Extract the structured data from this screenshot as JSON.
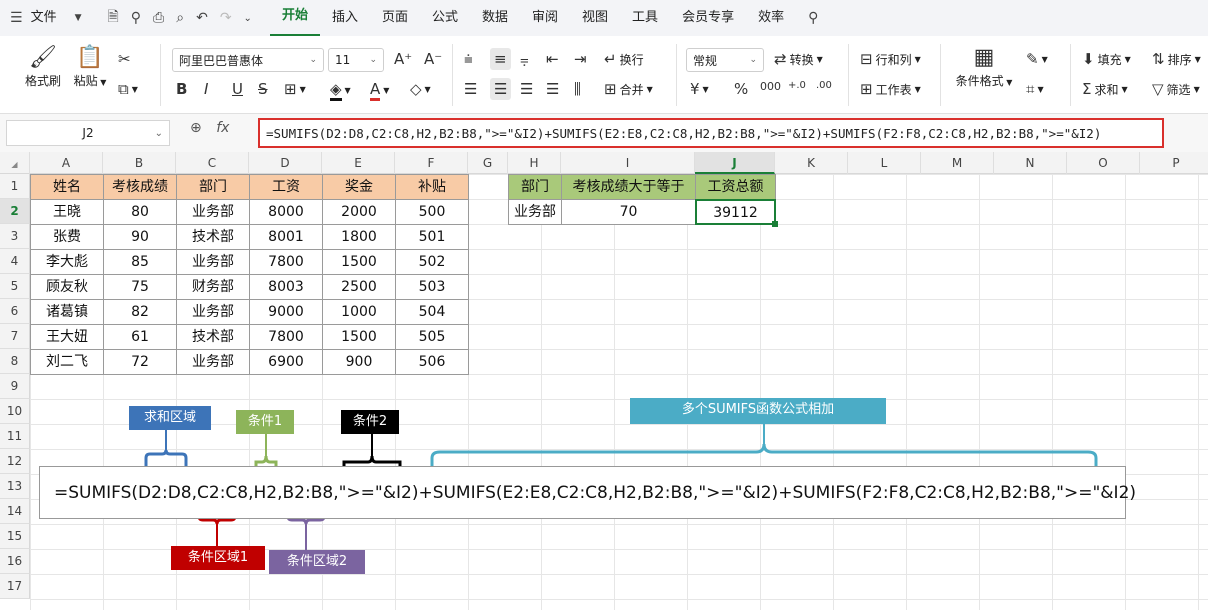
{
  "menubar": {
    "file_label": "文件",
    "tabs": [
      "开始",
      "插入",
      "页面",
      "公式",
      "数据",
      "审阅",
      "视图",
      "工具",
      "会员专享",
      "效率"
    ],
    "active_tab": "开始"
  },
  "ribbon": {
    "format_painter": "格式刷",
    "paste": "粘贴",
    "font_name": "阿里巴巴普惠体",
    "font_size": "11",
    "wrap": "换行",
    "merge": "合并",
    "number_format": "常规",
    "convert": "转换",
    "rows_cols": "行和列",
    "worksheet": "工作表",
    "cond_format": "条件格式",
    "fill": "填充",
    "sort": "排序",
    "sum": "求和",
    "filter": "筛选"
  },
  "formula_bar": {
    "name_box": "J2",
    "fx": "fx",
    "formula": "=SUMIFS(D2:D8,C2:C8,H2,B2:B8,\">=\"&I2)+SUMIFS(E2:E8,C2:C8,H2,B2:B8,\">=\"&I2)+SUMIFS(F2:F8,C2:C8,H2,B2:B8,\">=\"&I2)"
  },
  "columns": [
    "A",
    "B",
    "C",
    "D",
    "E",
    "F",
    "G",
    "H",
    "I",
    "J",
    "K",
    "L",
    "M",
    "N",
    "O",
    "P"
  ],
  "rows": [
    "1",
    "2",
    "3",
    "4",
    "5",
    "6",
    "7",
    "8",
    "9",
    "10",
    "11",
    "12",
    "13",
    "14",
    "15",
    "16",
    "17"
  ],
  "selected_cell": {
    "column": "J",
    "row": "2"
  },
  "table1": {
    "headers": [
      "姓名",
      "考核成绩",
      "部门",
      "工资",
      "奖金",
      "补贴"
    ],
    "rows": [
      [
        "王晓",
        "80",
        "业务部",
        "8000",
        "2000",
        "500"
      ],
      [
        "张费",
        "90",
        "技术部",
        "8001",
        "1800",
        "501"
      ],
      [
        "李大彪",
        "85",
        "业务部",
        "7800",
        "1500",
        "502"
      ],
      [
        "顾友秋",
        "75",
        "财务部",
        "8003",
        "2500",
        "503"
      ],
      [
        "诸葛镇",
        "82",
        "业务部",
        "9000",
        "1000",
        "504"
      ],
      [
        "王大妞",
        "61",
        "技术部",
        "7800",
        "1500",
        "505"
      ],
      [
        "刘二飞",
        "72",
        "业务部",
        "6900",
        "900",
        "506"
      ]
    ]
  },
  "table2": {
    "headers": [
      "部门",
      "考核成绩大于等于",
      "工资总额"
    ],
    "row": [
      "业务部",
      "70",
      "39112"
    ]
  },
  "annotations": {
    "sum_range": "求和区域",
    "condition1": "条件1",
    "condition2": "条件2",
    "multi_sumifs": "多个SUMIFS函数公式相加",
    "cond_range1": "条件区域1",
    "cond_range2": "条件区域2",
    "big_formula": "=SUMIFS(D2:D8,C2:C8,H2,B2:B8,\">=\"&I2)+SUMIFS(E2:E8,C2:C8,H2,B2:B8,\">=\"&I2)+SUMIFS(F2:F8,C2:C8,H2,B2:B8,\">=\"&I2)"
  },
  "colors": {
    "accent_green": "#1a7f37",
    "header_orange": "#f8cba6",
    "header_green": "#a9c97a",
    "sum_range_box": "#3d74b8",
    "condition1_box": "#8db45a",
    "condition2_box": "#000000",
    "multi_box": "#4bacc6",
    "cond_range1_box": "#c00000",
    "cond_range2_box": "#7b64a0",
    "formula_border": "#d9302c"
  }
}
